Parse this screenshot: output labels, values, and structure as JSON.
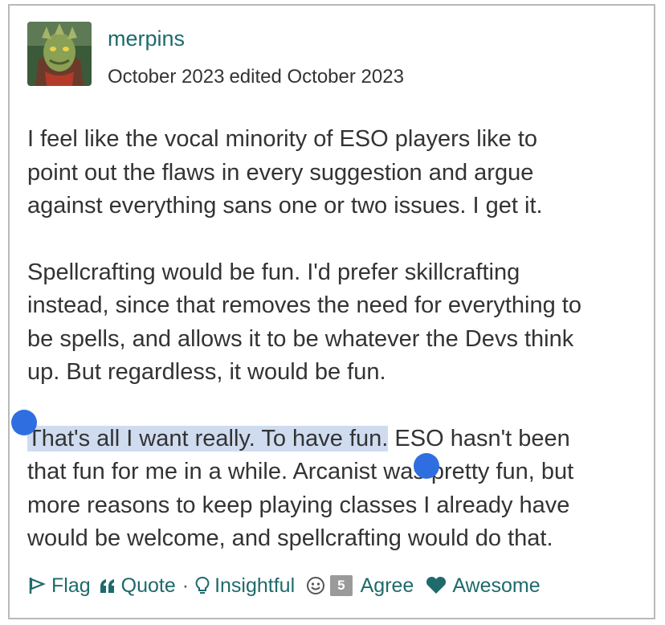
{
  "post": {
    "author": "merpins",
    "date": "October 2023",
    "edited": "edited October 2023",
    "paragraphs": [
      "I feel like the vocal minority of ESO players like to\npoint out the flaws in every suggestion and argue\nagainst everything sans one or two issues. I get it.",
      "Spellcrafting would be fun. I'd prefer skillcrafting\ninstead, since that removes the need for everything to\nbe spells, and allows it to be whatever the Devs think\nup. But regardless, it would be fun."
    ],
    "selected_text": "That's all I want really. To have fun.",
    "after_selected": " ESO hasn't been\nthat fun for me in a while. Arcanist was pretty fun, but\nmore reasons to keep playing classes I already have\nwould be welcome, and spellcrafting would do that."
  },
  "reactions": {
    "flag": "Flag",
    "quote": "Quote",
    "separator": "·",
    "insightful": "Insightful",
    "agree_count": "5",
    "agree": "Agree",
    "awesome": "Awesome"
  },
  "colors": {
    "accent": "#1e6a6c",
    "selection": "#cfdcf0",
    "handle": "#2f6ee0",
    "badge": "#9a9a9a"
  }
}
